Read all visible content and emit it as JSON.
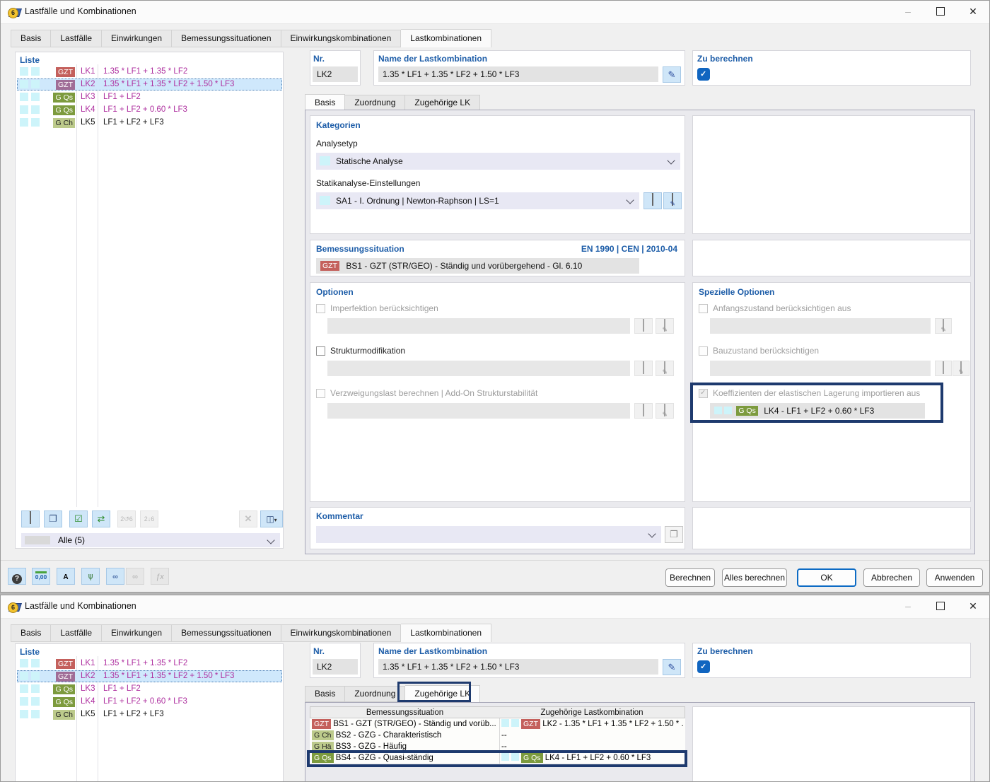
{
  "window": {
    "title": "Lastfälle und Kombinationen"
  },
  "main_tabs": [
    "Basis",
    "Lastfälle",
    "Einwirkungen",
    "Bemessungssituationen",
    "Einwirkungskombinationen",
    "Lastkombinationen"
  ],
  "sub_tabs": [
    "Basis",
    "Zuordnung",
    "Zugehörige LK"
  ],
  "liste": {
    "label": "Liste",
    "filter": "Alle (5)",
    "items": [
      {
        "badge": "GZT",
        "id": "LK1",
        "formula": "1.35 * LF1 + 1.35 * LF2"
      },
      {
        "badge": "GZT",
        "id": "LK2",
        "formula": "1.35 * LF1 + 1.35 * LF2 + 1.50 * LF3"
      },
      {
        "badge": "G Qs",
        "id": "LK3",
        "formula": "LF1 + LF2"
      },
      {
        "badge": "G Qs",
        "id": "LK4",
        "formula": "LF1 + LF2 + 0.60 * LF3"
      },
      {
        "badge": "G Ch",
        "id": "LK5",
        "formula": "LF1 + LF2 + LF3"
      }
    ]
  },
  "header": {
    "nr_label": "Nr.",
    "nr_value": "LK2",
    "name_label": "Name der Lastkombination",
    "name_value": "1.35 * LF1 + 1.35 * LF2 + 1.50 * LF3",
    "compute_label": "Zu berechnen"
  },
  "basis": {
    "kategorien": "Kategorien",
    "analysetyp_label": "Analysetyp",
    "analysetyp_value": "Statische Analyse",
    "statik_label": "Statikanalyse-Einstellungen",
    "statik_value": "SA1 - I. Ordnung | Newton-Raphson | LS=1",
    "bemessung_label": "Bemessungssituation",
    "norm": "EN 1990 | CEN | 2010-04",
    "bemessung_badge": "GZT",
    "bemessung_value": "BS1 - GZT (STR/GEO) - Ständig und vorübergehend - Gl. 6.10",
    "optionen": "Optionen",
    "opt_imperfektion": "Imperfektion berücksichtigen",
    "opt_struktur": "Strukturmodifikation",
    "opt_verzweigung": "Verzweigungslast berechnen | Add-On Strukturstabilität",
    "spezielle": "Spezielle Optionen",
    "sopt_anfang": "Anfangszustand berücksichtigen aus",
    "sopt_bau": "Bauzustand berücksichtigen",
    "sopt_koeff": "Koeffizienten der elastischen Lagerung importieren aus",
    "sopt_koeff_badge": "G Qs",
    "sopt_koeff_value": "LK4 - LF1 + LF2 + 0.60 * LF3",
    "kommentar": "Kommentar"
  },
  "footer": {
    "buttons": [
      "Berechnen",
      "Alles berechnen",
      "OK",
      "Abbrechen",
      "Anwenden"
    ]
  },
  "zugehoerige": {
    "col_bs": "Bemessungssituation",
    "col_lk": "Zugehörige Lastkombination",
    "rows": [
      {
        "badge": "GZT",
        "bs": "BS1 - GZT (STR/GEO) - Ständig und vorüb...",
        "lk_badge": "GZT",
        "lk": "LK2 - 1.35 * LF1 + 1.35 * LF2 + 1.50 * ..."
      },
      {
        "badge": "G Ch",
        "bs": "BS2 - GZG - Charakteristisch",
        "lk": "--"
      },
      {
        "badge": "G Hä",
        "bs": "BS3 - GZG - Häufig",
        "lk": "--"
      },
      {
        "badge": "G Qs",
        "bs": "BS4 - GZG - Quasi-ständig",
        "lk_badge": "G Qs",
        "lk": "LK4 - LF1 + LF2 + 0.60 * LF3"
      }
    ]
  },
  "colors": {
    "accent_blue": "#1d5da8",
    "selection": "#cfe8fc",
    "badge_gzt": "#c4605c",
    "badge_gqs": "#7d9b3e",
    "badge_gch": "#bcca8b",
    "highlight_navy": "#1e3a6e",
    "magenta": "#ae2f9f",
    "check_blue": "#1065c0"
  },
  "icons": {
    "app_badge": "6",
    "minimize": "–",
    "close": "✕",
    "edit_pencil": "✎",
    "new_star": "✦",
    "copy": "❐",
    "check_all": "☑",
    "swap": "⇄",
    "renumber_up": "2↺6",
    "renumber_down": "2↓6",
    "delete_x": "✕",
    "columns": "◫",
    "dropdown_arrow": "▾",
    "help": "?",
    "units": "0,00",
    "display_a": "A",
    "tree": "⋔",
    "link": "∞",
    "unlink": "∞",
    "fx": "ƒx"
  }
}
